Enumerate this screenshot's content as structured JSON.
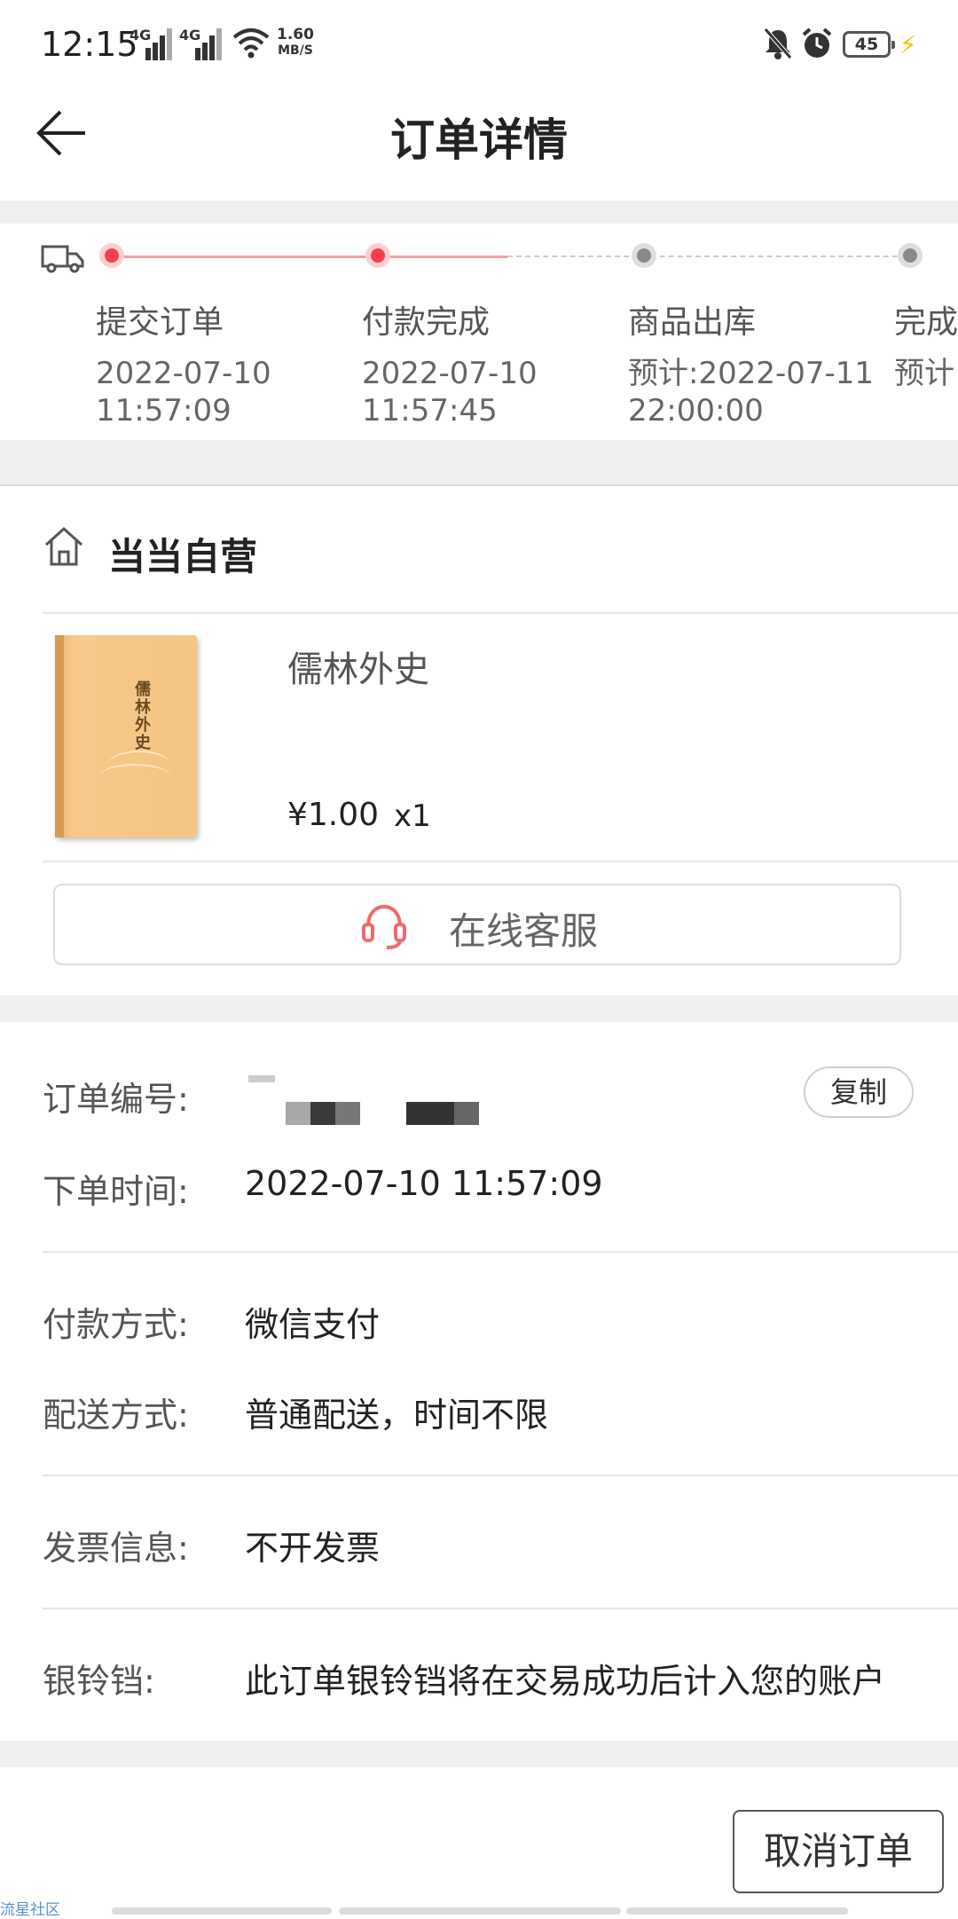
{
  "status_bar": {
    "time": "12:15",
    "signal1_label": "4G",
    "signal2_label": "4G",
    "speed_value": "1.60",
    "speed_unit": "MB/S",
    "battery": "45"
  },
  "header": {
    "title": "订单详情"
  },
  "progress": {
    "steps": [
      {
        "name": "提交订单",
        "line1": "2022-07-10",
        "line2": "11:57:09",
        "done": true
      },
      {
        "name": "付款完成",
        "line1": "2022-07-10",
        "line2": "11:57:45",
        "done": true
      },
      {
        "name": "商品出库",
        "line1": "预计:2022-07-11",
        "line2": "22:00:00",
        "done": false
      },
      {
        "name": "完成",
        "line1": "预计",
        "line2": "",
        "done": false
      }
    ]
  },
  "store": {
    "name": "当当自营",
    "product": {
      "title": "儒林外史",
      "cover_text": "儒林外史",
      "price": "¥1.00",
      "qty": "x1"
    },
    "customer_service": "在线客服"
  },
  "order_info": {
    "order_no_label": "订单编号:",
    "copy_button": "复制",
    "order_time_label": "下单时间:",
    "order_time": "2022-07-10 11:57:09",
    "payment_label": "付款方式:",
    "payment": "微信支付",
    "delivery_label": "配送方式:",
    "delivery": "普通配送，时间不限",
    "invoice_label": "发票信息:",
    "invoice": "不开发票",
    "coins_label": "银铃铛:",
    "coins": "此订单银铃铛将在交易成功后计入您的账户"
  },
  "actions": {
    "cancel": "取消订单"
  },
  "watermark": "流星社区",
  "colors": {
    "accent": "#f4404c",
    "inactive": "#8a8a8a",
    "divider": "#f0f0f0"
  }
}
